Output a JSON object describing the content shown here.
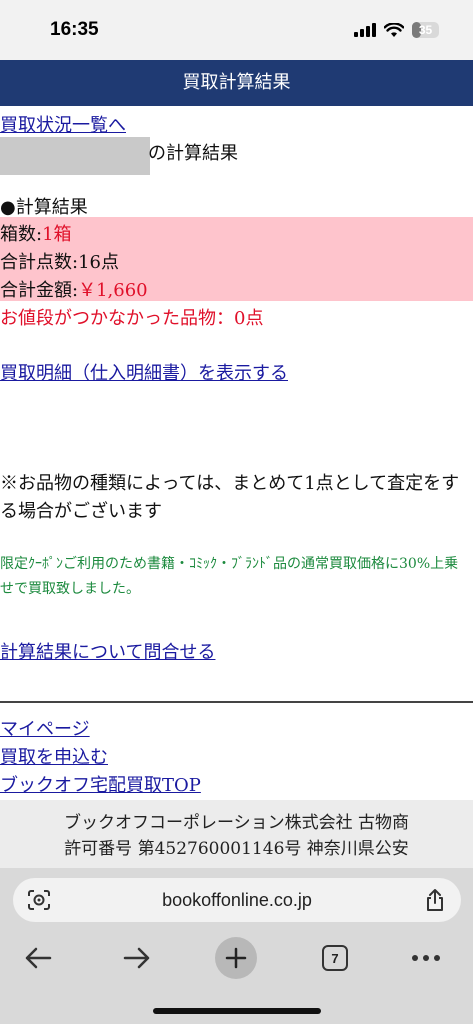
{
  "status_bar": {
    "time": "16:35",
    "battery": "35",
    "battery_fraction": 0.35
  },
  "header": {
    "title": "買取計算結果"
  },
  "content": {
    "back_link": "買取状況一覧へ",
    "result_suffix": "の計算結果",
    "section_heading": "●計算結果",
    "rows": [
      {
        "label": "箱数:",
        "value": "1箱"
      },
      {
        "label": "合計点数:",
        "value": "16点"
      },
      {
        "label": "合計金額:",
        "value": "￥1,660"
      }
    ],
    "no_price": "お値段がつかなかった品物：0点",
    "detail_link": "買取明細（仕入明細書）を表示する",
    "note": "※お品物の種類によっては、まとめて1点として査定をする場合がございます",
    "promo": "限定ｸｰﾎﾟﾝご利用のため書籍・ｺﾐｯｸ・ﾌﾞﾗﾝﾄﾞ品の通常買取価格に30%上乗せで買取致しました。",
    "inquiry_link": "計算結果について問合せる",
    "footer_links": [
      "マイページ",
      "買取を申込む",
      "ブックオフ宅配買取TOP"
    ]
  },
  "company": {
    "line1": "ブックオフコーポレーション株式会社 古物商",
    "line2": "許可番号 第452760001146号 神奈川県公安"
  },
  "browser": {
    "url": "bookoffonline.co.jp",
    "tab_count": "7"
  }
}
